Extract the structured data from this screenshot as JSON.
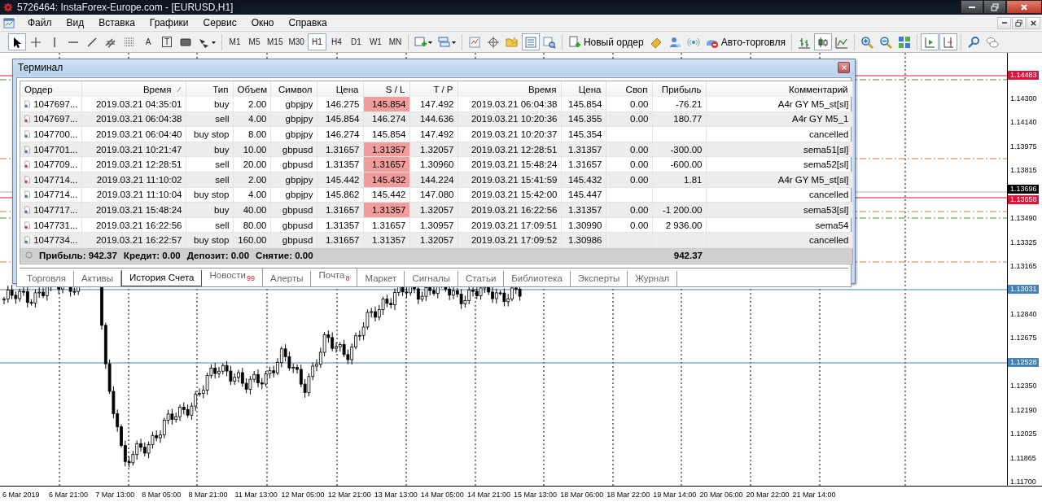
{
  "window": {
    "title": "5726464: InstaForex-Europe.com - [EURUSD,H1]"
  },
  "menu": [
    "Файл",
    "Вид",
    "Вставка",
    "Графики",
    "Сервис",
    "Окно",
    "Справка"
  ],
  "toolbar": [
    [
      {
        "selected": true
      },
      {
        "selected": false
      },
      {
        "selected": false
      },
      {
        "selected": false
      },
      {
        "selected": false
      },
      {
        "selected": false
      },
      {
        "selected": false
      },
      {
        "label": "A",
        "selected": false
      },
      {
        "label": "T",
        "selected": false
      },
      {
        "selected": false
      },
      {
        "selected": false
      }
    ],
    [
      {
        "label": "M1",
        "selected": false
      },
      {
        "label": "M5",
        "selected": false
      },
      {
        "label": "M15",
        "selected": false
      },
      {
        "label": "M30",
        "selected": false
      },
      {
        "label": "H1",
        "selected": true
      },
      {
        "label": "H4",
        "selected": false
      },
      {
        "label": "D1",
        "selected": false
      },
      {
        "label": "W1",
        "selected": false
      },
      {
        "label": "MN",
        "selected": false
      }
    ],
    [
      {
        "selected": false
      },
      {
        "selected": false
      }
    ],
    [
      {
        "selected": false
      },
      {
        "selected": false
      },
      {
        "selected": false
      },
      {
        "selected": true
      },
      {
        "selected": false
      }
    ],
    [
      {
        "label": "Новый ордер",
        "selected": false
      },
      {
        "selected": false
      },
      {
        "selected": false
      },
      {
        "selected": false
      },
      {
        "label": "Авто-торговля",
        "selected": false
      }
    ],
    [
      {
        "selected": false
      },
      {
        "selected": true
      },
      {
        "selected": false
      }
    ],
    [
      {
        "selected": false
      },
      {
        "selected": false
      },
      {
        "selected": false
      }
    ],
    [
      {
        "selected": true
      },
      {
        "selected": true
      }
    ],
    [
      {
        "selected": false
      },
      {
        "selected": false
      }
    ]
  ],
  "chart": {
    "price_axis": [
      "1.14300",
      "1.14140",
      "1.13975",
      "1.13815",
      "1.13490",
      "1.13325",
      "1.13165",
      "1.12840",
      "1.12675",
      "1.12350",
      "1.12190",
      "1.12025",
      "1.11865",
      "1.11700"
    ],
    "price_tags": [
      {
        "text": "1.14483",
        "color": "#dc143c"
      },
      {
        "text": "1.13696",
        "color": "#000000"
      },
      {
        "text": "1.13658",
        "color": "#dc143c"
      },
      {
        "text": "1.13031",
        "color": "#4682b4"
      },
      {
        "text": "1.12528",
        "color": "#4682b4"
      }
    ],
    "time_axis": [
      "6 Mar 2019",
      "6 Mar 21:00",
      "7 Mar 13:00",
      "8 Mar 05:00",
      "8 Mar 21:00",
      "11 Mar 13:00",
      "12 Mar 05:00",
      "12 Mar 21:00",
      "13 Mar 13:00",
      "14 Mar 05:00",
      "14 Mar 21:00",
      "15 Mar 13:00",
      "18 Mar 06:00",
      "18 Mar 22:00",
      "19 Mar 14:00",
      "20 Mar 06:00",
      "20 Mar 22:00",
      "21 Mar 14:00"
    ]
  },
  "terminal": {
    "title": "Терминал",
    "columns": [
      "Ордер",
      "Время",
      "Тип",
      "Объем",
      "Символ",
      "Цена",
      "S / L",
      "T / P",
      "Время",
      "Цена",
      "Своп",
      "Прибыль",
      "Комментарий"
    ],
    "rows": [
      {
        "kind": "buy",
        "order": "1047697...",
        "open_time": "2019.03.21 04:35:01",
        "type": "buy",
        "volume": "2.00",
        "symbol": "gbpjpy",
        "price": "146.275",
        "sl": "145.854",
        "sl_hit": true,
        "tp": "147.492",
        "close_time": "2019.03.21 06:04:38",
        "close_price": "145.854",
        "swap": "0.00",
        "profit": "-76.21",
        "comment": "A4r GY M5_st[sl]"
      },
      {
        "kind": "sell",
        "order": "1047697...",
        "open_time": "2019.03.21 06:04:38",
        "type": "sell",
        "volume": "4.00",
        "symbol": "gbpjpy",
        "price": "145.854",
        "sl": "146.274",
        "sl_hit": false,
        "tp": "144.636",
        "close_time": "2019.03.21 10:20:36",
        "close_price": "145.355",
        "swap": "0.00",
        "profit": "180.77",
        "comment": "A4r GY M5_1"
      },
      {
        "kind": "buy",
        "order": "1047700...",
        "open_time": "2019.03.21 06:04:40",
        "type": "buy stop",
        "volume": "8.00",
        "symbol": "gbpjpy",
        "price": "146.274",
        "sl": "145.854",
        "sl_hit": false,
        "tp": "147.492",
        "close_time": "2019.03.21 10:20:37",
        "close_price": "145.354",
        "comment": "cancelled"
      },
      {
        "kind": "buy",
        "order": "1047701...",
        "open_time": "2019.03.21 10:21:47",
        "type": "buy",
        "volume": "10.00",
        "symbol": "gbpusd",
        "price": "1.31657",
        "sl": "1.31357",
        "sl_hit": true,
        "tp": "1.32057",
        "close_time": "2019.03.21 12:28:51",
        "close_price": "1.31357",
        "swap": "0.00",
        "profit": "-300.00",
        "comment": "sema51[sl]"
      },
      {
        "kind": "sell",
        "order": "1047709...",
        "open_time": "2019.03.21 12:28:51",
        "type": "sell",
        "volume": "20.00",
        "symbol": "gbpusd",
        "price": "1.31357",
        "sl": "1.31657",
        "sl_hit": true,
        "tp": "1.30960",
        "close_time": "2019.03.21 15:48:24",
        "close_price": "1.31657",
        "swap": "0.00",
        "profit": "-600.00",
        "comment": "sema52[sl]"
      },
      {
        "kind": "sell",
        "order": "1047714...",
        "open_time": "2019.03.21 11:10:02",
        "type": "sell",
        "volume": "2.00",
        "symbol": "gbpjpy",
        "price": "145.442",
        "sl": "145.432",
        "sl_hit": true,
        "tp": "144.224",
        "close_time": "2019.03.21 15:41:59",
        "close_price": "145.432",
        "swap": "0.00",
        "profit": "1.81",
        "comment": "A4r GY M5_st[sl]"
      },
      {
        "kind": "buy",
        "order": "1047714...",
        "open_time": "2019.03.21 11:10:04",
        "type": "buy stop",
        "volume": "4.00",
        "symbol": "gbpjpy",
        "price": "145.862",
        "sl": "145.442",
        "sl_hit": false,
        "tp": "147.080",
        "close_time": "2019.03.21 15:42:00",
        "close_price": "145.447",
        "comment": "cancelled"
      },
      {
        "kind": "buy",
        "order": "1047717...",
        "open_time": "2019.03.21 15:48:24",
        "type": "buy",
        "volume": "40.00",
        "symbol": "gbpusd",
        "price": "1.31657",
        "sl": "1.31357",
        "sl_hit": true,
        "tp": "1.32057",
        "close_time": "2019.03.21 16:22:56",
        "close_price": "1.31357",
        "swap": "0.00",
        "profit": "-1 200.00",
        "comment": "sema53[sl]"
      },
      {
        "kind": "sell",
        "order": "1047731...",
        "open_time": "2019.03.21 16:22:56",
        "type": "sell",
        "volume": "80.00",
        "symbol": "gbpusd",
        "price": "1.31357",
        "sl": "1.31657",
        "sl_hit": false,
        "tp": "1.30957",
        "close_time": "2019.03.21 17:09:51",
        "close_price": "1.30990",
        "swap": "0.00",
        "profit": "2 936.00",
        "comment": "sema54"
      },
      {
        "kind": "buy",
        "order": "1047734...",
        "open_time": "2019.03.21 16:22:57",
        "type": "buy stop",
        "volume": "160.00",
        "symbol": "gbpusd",
        "price": "1.31657",
        "sl": "1.31357",
        "sl_hit": false,
        "tp": "1.32057",
        "close_time": "2019.03.21 17:09:52",
        "close_price": "1.30986",
        "comment": "cancelled"
      }
    ],
    "summary": [
      "Прибыль: 942.37",
      "Кредит: 0.00",
      "Депозит: 0.00",
      "Снятие: 0.00"
    ],
    "summary_total": "942.37",
    "tabs": [
      {
        "label": "Торговля",
        "selected": false
      },
      {
        "label": "Активы",
        "selected": false
      },
      {
        "label": "История Счета",
        "selected": true
      },
      {
        "label": "Новости",
        "badge": "99",
        "selected": false
      },
      {
        "label": "Алерты",
        "selected": false
      },
      {
        "label": "Почта",
        "badge": "8",
        "selected": false
      },
      {
        "label": "Маркет",
        "selected": false
      },
      {
        "label": "Сигналы",
        "selected": false
      },
      {
        "label": "Статьи",
        "selected": false
      },
      {
        "label": "Библиотека",
        "selected": false
      },
      {
        "label": "Эксперты",
        "selected": false
      },
      {
        "label": "Журнал",
        "selected": false
      }
    ]
  }
}
